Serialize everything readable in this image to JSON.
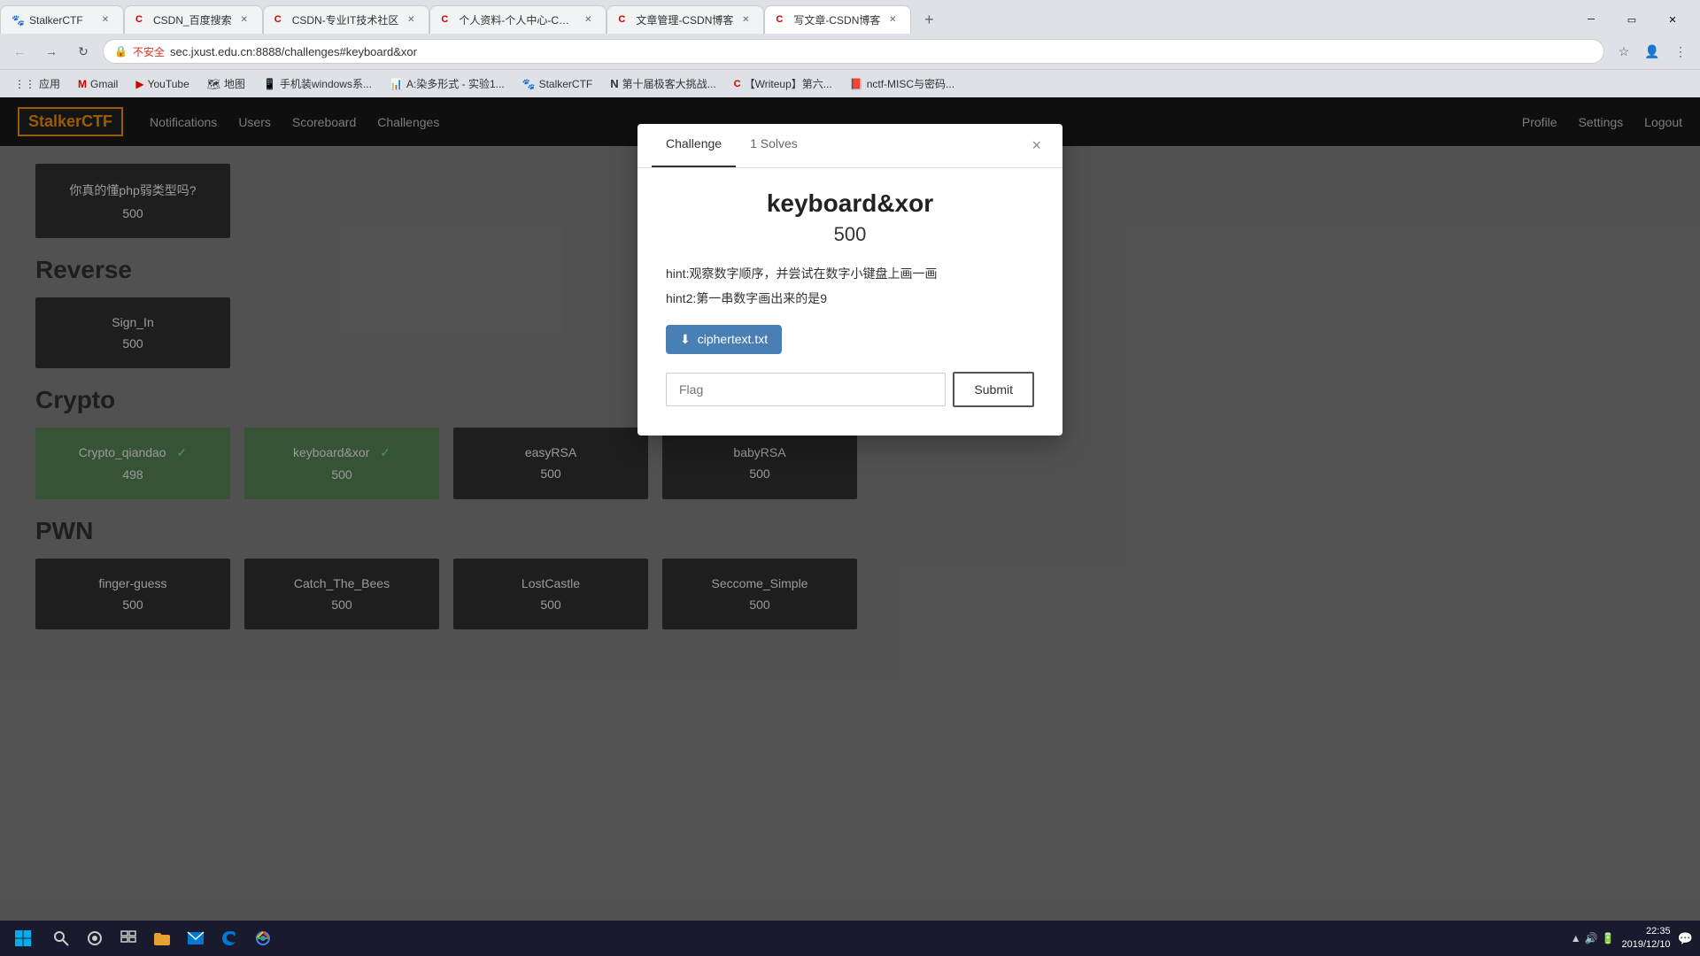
{
  "browser": {
    "tabs": [
      {
        "id": "tab1",
        "favicon": "🐾",
        "title": "StalkerCTF",
        "active": false
      },
      {
        "id": "tab2",
        "favicon": "🔴",
        "title": "CSDN_百度搜索",
        "active": false
      },
      {
        "id": "tab3",
        "favicon": "🔴",
        "title": "CSDN-专业IT技术社区",
        "active": false
      },
      {
        "id": "tab4",
        "favicon": "🔴",
        "title": "个人资料-个人中心-CSDN",
        "active": false
      },
      {
        "id": "tab5",
        "favicon": "🔴",
        "title": "文章管理-CSDN博客",
        "active": false
      },
      {
        "id": "tab6",
        "favicon": "🔴",
        "title": "写文章-CSDN博客",
        "active": true
      }
    ],
    "address": "sec.jxust.edu.cn:8888/challenges#keyboard&xor",
    "security": "不安全"
  },
  "bookmarks": [
    {
      "favicon": "📱",
      "label": "应用"
    },
    {
      "favicon": "M",
      "label": "Gmail"
    },
    {
      "favicon": "▶",
      "label": "YouTube"
    },
    {
      "favicon": "🗺",
      "label": "地图"
    },
    {
      "favicon": "📧",
      "label": "手机装windows系..."
    },
    {
      "favicon": "📊",
      "label": "A:染多形式 - 实验1..."
    },
    {
      "favicon": "🐾",
      "label": "StalkerCTF"
    },
    {
      "favicon": "N",
      "label": "第十届极客大挑战..."
    },
    {
      "favicon": "🔴",
      "label": "【Writeup】第六..."
    },
    {
      "favicon": "📕",
      "label": "nctf-MISC与密码..."
    }
  ],
  "navbar": {
    "brand": "Stalker",
    "brand_highlight": "CTF",
    "links": [
      "Notifications",
      "Users",
      "Scoreboard",
      "Challenges"
    ],
    "right_links": [
      "Profile",
      "Settings",
      "Logout"
    ]
  },
  "background": {
    "php_challenge": {
      "name": "你真的懂php弱类型吗?",
      "points": "500"
    },
    "categories": [
      {
        "name": "Reverse",
        "challenges": [
          {
            "name": "Sign_In",
            "points": "500",
            "solved": false
          }
        ]
      },
      {
        "name": "Crypto",
        "challenges": [
          {
            "name": "Crypto_qiandao",
            "points": "498",
            "solved": true
          },
          {
            "name": "keyboard&xor",
            "points": "500",
            "solved": true
          },
          {
            "name": "easyRSA",
            "points": "500",
            "solved": false
          },
          {
            "name": "babyRSA",
            "points": "500",
            "solved": false
          }
        ]
      },
      {
        "name": "PWN",
        "challenges": [
          {
            "name": "finger-guess",
            "points": "500",
            "solved": false
          },
          {
            "name": "Catch_The_Bees",
            "points": "500",
            "solved": false
          },
          {
            "name": "LostCastle",
            "points": "500",
            "solved": false
          },
          {
            "name": "Seccome_Simple",
            "points": "500",
            "solved": false
          }
        ]
      }
    ]
  },
  "modal": {
    "tabs": [
      "Challenge",
      "1 Solves"
    ],
    "active_tab": "Challenge",
    "title": "keyboard&xor",
    "points": "500",
    "hint1": "hint:观察数字顺序，并尝试在数字小键盘上画一画",
    "hint2": "hint2:第一串数字画出来的是9",
    "download_label": "ciphertext.txt",
    "flag_placeholder": "Flag",
    "submit_label": "Submit",
    "close_label": "×"
  },
  "taskbar": {
    "time": "22:35",
    "date": "2019/12/10"
  }
}
